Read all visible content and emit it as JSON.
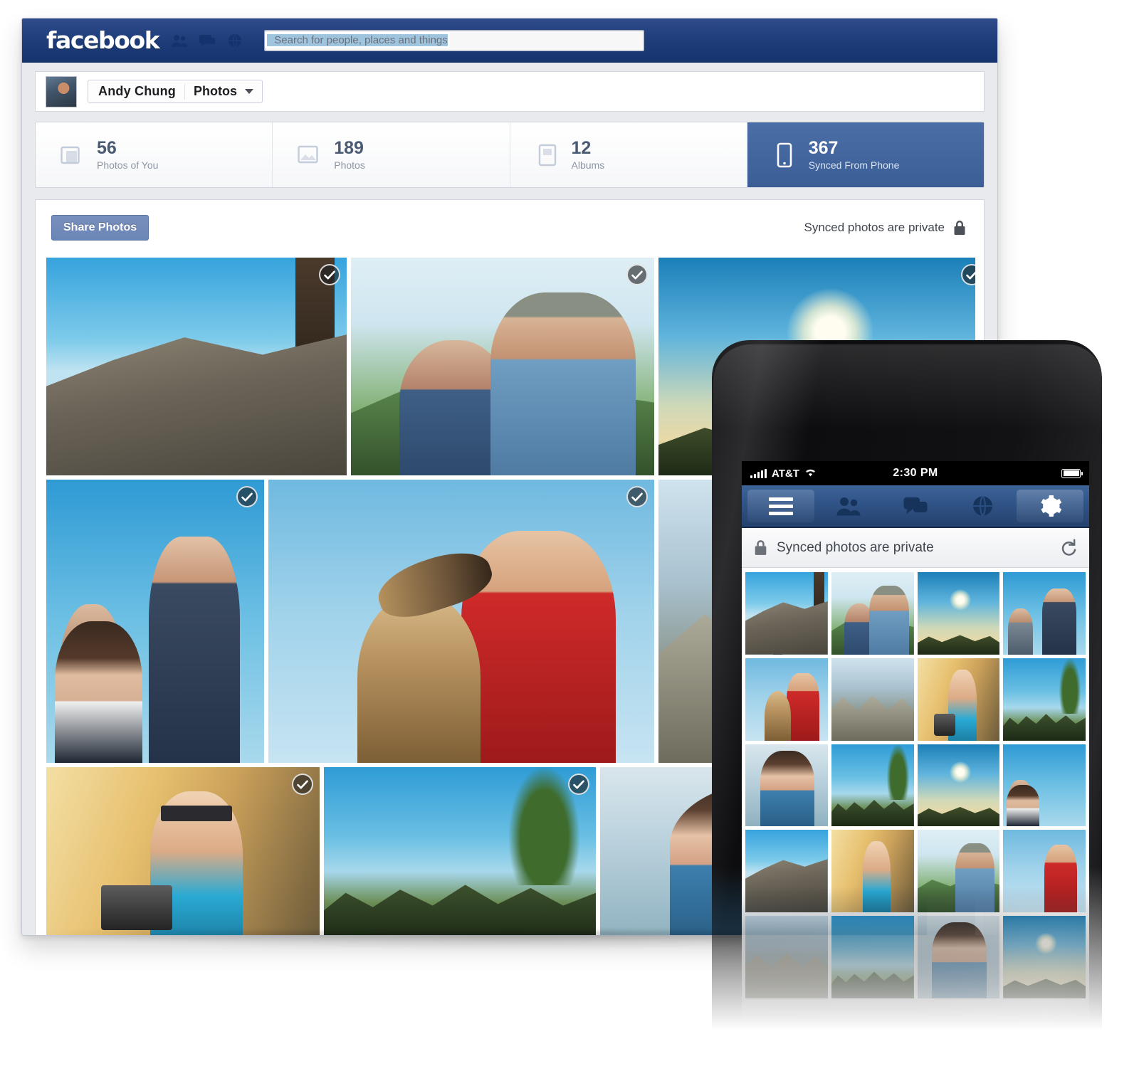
{
  "browser": {
    "header": {
      "logo": "facebook",
      "nav_icons": [
        "friend-requests-icon",
        "messages-icon",
        "notifications-globe-icon"
      ],
      "search": {
        "placeholder": "Search for people, places and things",
        "value": "",
        "button_icon": "search-icon"
      }
    },
    "profile_bar": {
      "avatar": "user-avatar",
      "name": "Andy Chung",
      "section": "Photos",
      "caret_icon": "chevron-down-icon"
    },
    "stats": [
      {
        "count": "56",
        "label": "Photos of You",
        "icon": "photos-of-you-icon",
        "active": false
      },
      {
        "count": "189",
        "label": "Photos",
        "icon": "photos-icon",
        "active": false
      },
      {
        "count": "12",
        "label": "Albums",
        "icon": "albums-icon",
        "active": false
      },
      {
        "count": "367",
        "label": "Synced From Phone",
        "icon": "phone-icon",
        "active": true
      }
    ],
    "toolbar": {
      "share_label": "Share Photos",
      "privacy_note": "Synced photos are private",
      "privacy_icon": "lock-icon"
    },
    "grid": {
      "check_icon": "checkmark-icon",
      "photos": [
        {
          "alt": "hikers-below-rock-cliff",
          "style": "p-cliff",
          "checked": true
        },
        {
          "alt": "couple-in-sunlit-hills",
          "style": "p-couple",
          "checked": true
        },
        {
          "alt": "sunset-over-ridge",
          "style": "p-sun",
          "checked": true
        },
        {
          "alt": "three-friends-blue-sky",
          "style": "p-group",
          "checked": true
        },
        {
          "alt": "dog-licking-man-in-red-shirt",
          "style": "p-dog",
          "checked": true
        },
        {
          "alt": "person-on-rocks",
          "style": "p-rocks",
          "checked": false
        },
        {
          "alt": "man-with-sunglasses-and-camera",
          "style": "p-selfie",
          "checked": true
        },
        {
          "alt": "crowd-under-trees",
          "style": "p-crowd",
          "checked": true
        },
        {
          "alt": "woman-in-profile",
          "style": "p-girl",
          "checked": false
        }
      ]
    }
  },
  "phone": {
    "status_bar": {
      "carrier": "AT&T",
      "signal_icon": "signal-bars-icon",
      "wifi_icon": "wifi-icon",
      "time": "2:30 PM",
      "battery_icon": "battery-full-icon"
    },
    "nav": [
      {
        "icon": "hamburger-menu-icon",
        "active": true
      },
      {
        "icon": "friend-requests-icon",
        "active": false
      },
      {
        "icon": "messages-icon",
        "active": false
      },
      {
        "icon": "globe-notifications-icon",
        "active": false
      },
      {
        "icon": "gear-settings-icon",
        "active": true
      }
    ],
    "privacy": {
      "lock_icon": "lock-icon",
      "text": "Synced photos are private",
      "refresh_icon": "refresh-icon"
    },
    "thumbnails": [
      "p-cliff",
      "p-couple",
      "p-sun",
      "p-group",
      "p-dog",
      "p-rocks",
      "p-selfie",
      "p-crowd",
      "p-girl",
      "p-crowd",
      "p-sun",
      "p-group",
      "p-cliff",
      "p-selfie",
      "p-couple",
      "p-dog",
      "p-rocks",
      "p-crowd",
      "p-girl",
      "p-sun"
    ]
  },
  "colors": {
    "facebook_blue": "#1d3c78",
    "active_tab_blue": "#4b6ea6",
    "share_button_blue": "#7890bd",
    "page_background": "#ffffff",
    "card_background": "#ffffff"
  }
}
